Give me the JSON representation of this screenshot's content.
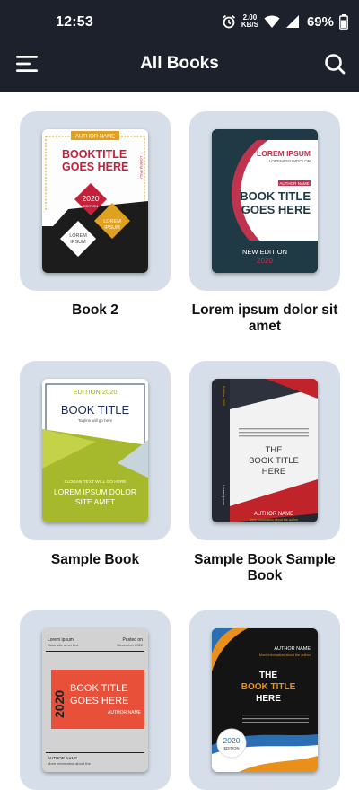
{
  "status_bar": {
    "time": "12:53",
    "net_speed_value": "2.00",
    "net_speed_unit": "KB/S",
    "battery": "69%",
    "icons": [
      "alarm-icon",
      "wifi-icon",
      "cellular-signal-icon",
      "battery-icon"
    ]
  },
  "app_bar": {
    "title": "All Books",
    "menu_icon": "hamburger-menu-icon",
    "search_icon": "search-icon"
  },
  "colors": {
    "app_bar": "#1d212b",
    "card_background": "#d6dfe9"
  },
  "books": [
    {
      "title": "Book 2",
      "cover": {
        "author": "AUTHOR NAME",
        "title_line1": "BOOKTITLE",
        "title_line2": "GOES HERE",
        "side": "LOREM IPSU",
        "year": "2020",
        "edition": "EDITION",
        "lorem1": "LOREM",
        "ipsum1": "IPSUM",
        "lorem2": "LOREM",
        "ipsum2": "IPSUM"
      }
    },
    {
      "title": "Lorem ipsum dolor sit amet",
      "cover": {
        "brand": "LOREM IPSUM",
        "brand_sub": "LOREMIPSUMDOLOR",
        "author": "AUTHOR NAME",
        "title_line1": "BOOK TITLE",
        "title_line2": "GOES HERE",
        "edition": "NEW EDITION",
        "year": "2020"
      }
    },
    {
      "title": "Sample Book",
      "cover": {
        "edition": "EDITION 2020",
        "title": "BOOK TITLE",
        "tagline": "Tagline will go here",
        "slogan": "SLOGAN TEXT WILL GO HERE",
        "line1": "LOREM IPSUM DOLOR",
        "line2": "SITE AMET"
      }
    },
    {
      "title": "Sample Book Sample Book",
      "cover": {
        "spine_top": "Edition 2020",
        "spine_bottom": "Lorem ipsum",
        "title_line1": "THE",
        "title_line2": "BOOK TITLE",
        "title_line3": "HERE",
        "author": "AUTHOR NAME",
        "info": "More information about the author"
      }
    },
    {
      "title": "",
      "cover": {
        "left_top": "Lorem ipsum",
        "left_sub": "Dolor site amet text",
        "right_top": "Posted on",
        "right_sub": "December 2020",
        "year": "2020",
        "title_line1": "BOOK TITLE",
        "title_line2": "GOES HERE",
        "author": "AUTHOR NAME",
        "bottom_label": "AUTHOR NAME",
        "bottom_info": "More information about the"
      }
    },
    {
      "title": "",
      "cover": {
        "author": "AUTHOR NAME",
        "info": "More information about the author",
        "title_line1": "THE",
        "title_line2": "BOOK TITLE",
        "title_line3": "HERE",
        "year": "2020",
        "edition": "EDITION"
      }
    }
  ]
}
